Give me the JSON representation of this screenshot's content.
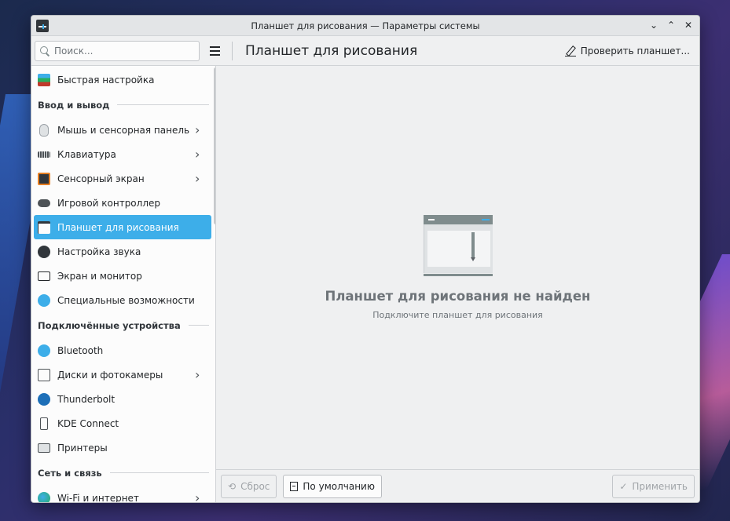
{
  "window": {
    "title": "Планшет для рисования — Параметры системы",
    "controls": [
      "⌄",
      "⌃",
      "✕"
    ]
  },
  "toolbar": {
    "search_placeholder": "Поиск...",
    "page_title": "Планшет для рисования",
    "check_tablet_label": "Проверить планшет..."
  },
  "sidebar": {
    "quick_settings": {
      "label": "Быстрая настройка",
      "icon": "quick-settings-icon"
    },
    "sections": [
      {
        "title": "Ввод и вывод",
        "items": [
          {
            "label": "Мышь и сенсорная панель",
            "icon": "mouse-icon",
            "chevron": true
          },
          {
            "label": "Клавиатура",
            "icon": "keyboard-icon",
            "chevron": true
          },
          {
            "label": "Сенсорный экран",
            "icon": "touchscreen-icon",
            "chevron": true
          },
          {
            "label": "Игровой контроллер",
            "icon": "gamepad-icon",
            "chevron": false
          },
          {
            "label": "Планшет для рисования",
            "icon": "drawing-tablet-icon",
            "chevron": false,
            "active": true
          },
          {
            "label": "Настройка звука",
            "icon": "sound-icon",
            "chevron": false
          },
          {
            "label": "Экран и монитор",
            "icon": "monitor-icon",
            "chevron": false
          },
          {
            "label": "Специальные возможности",
            "icon": "accessibility-icon",
            "chevron": false
          }
        ]
      },
      {
        "title": "Подключённые устройства",
        "items": [
          {
            "label": "Bluetooth",
            "icon": "bluetooth-icon",
            "chevron": false
          },
          {
            "label": "Диски и фотокамеры",
            "icon": "disks-icon",
            "chevron": true
          },
          {
            "label": "Thunderbolt",
            "icon": "thunderbolt-icon",
            "chevron": false
          },
          {
            "label": "KDE Connect",
            "icon": "kde-connect-icon",
            "chevron": false
          },
          {
            "label": "Принтеры",
            "icon": "printer-icon",
            "chevron": false
          }
        ]
      },
      {
        "title": "Сеть и связь",
        "items": [
          {
            "label": "Wi-Fi и интернет",
            "icon": "wifi-icon",
            "chevron": true
          }
        ]
      }
    ]
  },
  "main": {
    "empty_title": "Планшет для рисования не найден",
    "empty_subtitle": "Подключите планшет для рисования"
  },
  "footer": {
    "reset_label": "Сброс",
    "defaults_label": "По умолчанию",
    "apply_label": "Применить"
  },
  "colors": {
    "accent": "#3daee9",
    "window_bg": "#eff0f1",
    "sidebar_bg": "#fcfcfc"
  }
}
